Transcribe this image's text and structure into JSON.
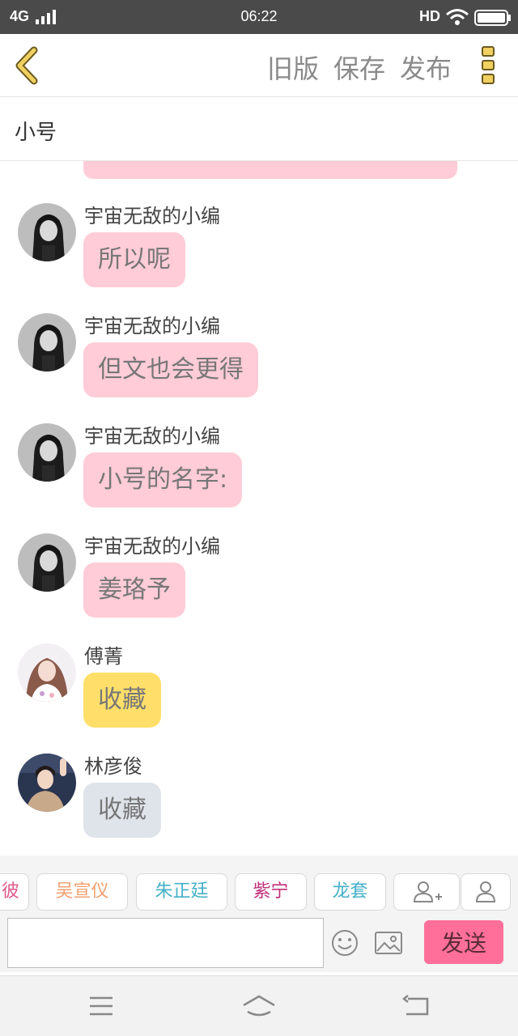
{
  "status_bar": {
    "network": "4G",
    "time": "06:22",
    "hd": "HD"
  },
  "nav": {
    "actions": [
      "旧版",
      "保存",
      "发布"
    ]
  },
  "subheader": {
    "title": "小号"
  },
  "messages": [
    {
      "sender": "宇宙无敌的小编",
      "text": "所以呢",
      "bubble": "pink",
      "avatar": "dark-avatar"
    },
    {
      "sender": "宇宙无敌的小编",
      "text": "但文也会更得",
      "bubble": "pink",
      "avatar": "dark-avatar"
    },
    {
      "sender": "宇宙无敌的小编",
      "text": "小号的名字:",
      "bubble": "pink",
      "avatar": "dark-avatar"
    },
    {
      "sender": "宇宙无敌的小编",
      "text": "姜珞予",
      "bubble": "pink",
      "avatar": "dark-avatar"
    },
    {
      "sender": "傅菁",
      "text": "收藏",
      "bubble": "yellow",
      "avatar": "light-avatar"
    },
    {
      "sender": "林彦俊",
      "text": "收藏",
      "bubble": "gray",
      "avatar": "boy-avatar"
    }
  ],
  "chips": [
    {
      "label": "彼",
      "color": "#e05a8c"
    },
    {
      "label": "吴宣仪",
      "color": "#f0a070"
    },
    {
      "label": "朱正廷",
      "color": "#45b0c8"
    },
    {
      "label": "紫宁",
      "color": "#c0307a"
    },
    {
      "label": "龙套",
      "color": "#45b0c8"
    }
  ],
  "input": {
    "placeholder": "",
    "send_label": "发送"
  },
  "colors": {
    "pink_bubble": "#ffccd7",
    "yellow_bubble": "#ffdf6a",
    "gray_bubble": "#dee4ea",
    "send_button": "#ff6f9a",
    "accent_icon": "#f0d060"
  },
  "icons": [
    "back-icon",
    "more-icon",
    "add-user-icon",
    "user-icon",
    "emoji-icon",
    "image-icon",
    "menu-icon",
    "home-icon",
    "return-icon"
  ]
}
